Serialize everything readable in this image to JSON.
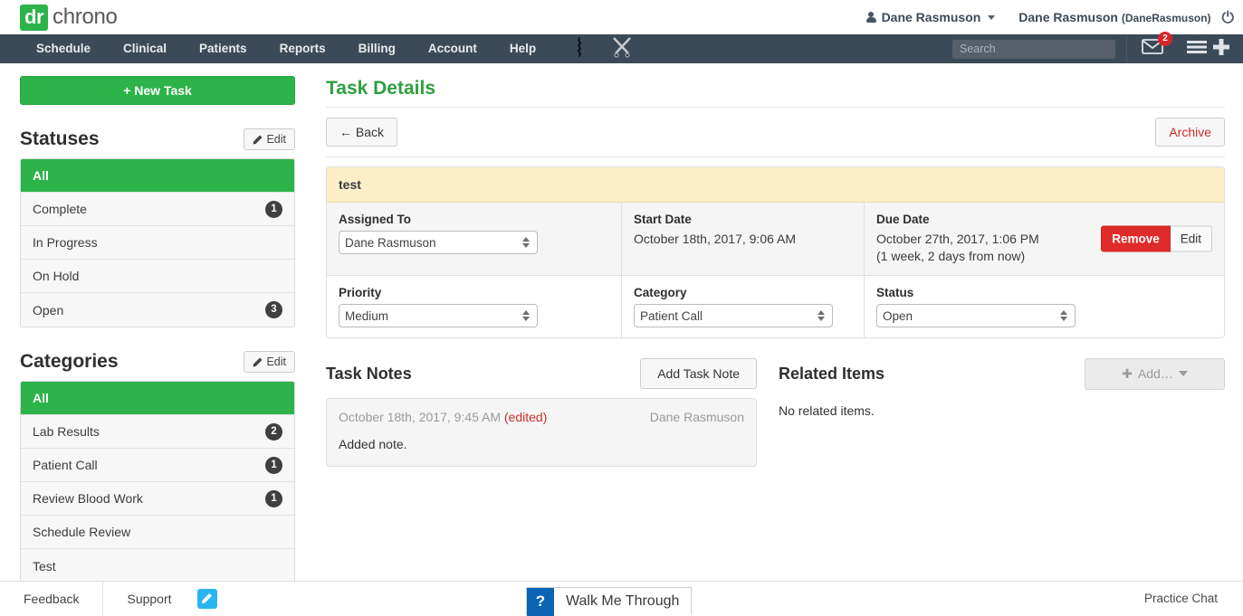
{
  "brand": {
    "logo_prefix": "dr",
    "logo_suffix": "chrono",
    "green": "#2cb34a",
    "navy": "#3a4a58"
  },
  "topbar": {
    "user_dropdown": "Dane Rasmuson",
    "account_name": "Dane Rasmuson",
    "account_handle": "(DaneRasmuson)",
    "person_icon": "person-icon",
    "power_icon": "power-icon"
  },
  "nav": {
    "items": [
      {
        "label": "Schedule"
      },
      {
        "label": "Clinical"
      },
      {
        "label": "Patients"
      },
      {
        "label": "Reports"
      },
      {
        "label": "Billing"
      },
      {
        "label": "Account"
      },
      {
        "label": "Help"
      }
    ],
    "icons": [
      {
        "name": "rod-of-asclepius-icon"
      },
      {
        "name": "crossed-swords-icon"
      }
    ],
    "search_placeholder": "Search",
    "search_value": "",
    "messages_badge": "2",
    "messages_icon": "envelope-icon",
    "menu_icon": "hamburger-icon",
    "add_icon": "plus-icon"
  },
  "sidebar": {
    "new_task_label": "+ New Task",
    "statuses": {
      "title": "Statuses",
      "edit_label": "Edit",
      "items": [
        {
          "label": "All",
          "count": "",
          "active": true
        },
        {
          "label": "Complete",
          "count": "1",
          "active": false
        },
        {
          "label": "In Progress",
          "count": "",
          "active": false
        },
        {
          "label": "On Hold",
          "count": "",
          "active": false
        },
        {
          "label": "Open",
          "count": "3",
          "active": false
        }
      ]
    },
    "categories": {
      "title": "Categories",
      "edit_label": "Edit",
      "items": [
        {
          "label": "All",
          "count": "",
          "active": true
        },
        {
          "label": "Lab Results",
          "count": "2",
          "active": false
        },
        {
          "label": "Patient Call",
          "count": "1",
          "active": false
        },
        {
          "label": "Review Blood Work",
          "count": "1",
          "active": false
        },
        {
          "label": "Schedule Review",
          "count": "",
          "active": false
        },
        {
          "label": "Test",
          "count": "",
          "active": false
        }
      ]
    }
  },
  "main": {
    "page_title": "Task Details",
    "back_label": "← Back",
    "archive_label": "Archive",
    "task": {
      "title": "test",
      "assigned_to_label": "Assigned To",
      "assigned_to_value": "Dane Rasmuson",
      "start_date_label": "Start Date",
      "start_date_value": "October 18th, 2017, 9:06 AM",
      "due_date_label": "Due Date",
      "due_date_value": "October 27th, 2017, 1:06 PM",
      "due_date_relative": "(1 week, 2 days from now)",
      "due_remove_label": "Remove",
      "due_edit_label": "Edit",
      "priority_label": "Priority",
      "priority_value": "Medium",
      "category_label": "Category",
      "category_value": "Patient Call",
      "status_label": "Status",
      "status_value": "Open"
    },
    "notes": {
      "title": "Task Notes",
      "add_label": "Add Task Note",
      "entries": [
        {
          "timestamp": "October 18th, 2017, 9:45 AM",
          "edited": "(edited)",
          "author": "Dane Rasmuson",
          "body": "Added note."
        }
      ]
    },
    "related": {
      "title": "Related Items",
      "add_label": "Add…",
      "add_plus": "✚",
      "empty_text": "No related items."
    }
  },
  "footer": {
    "feedback_label": "Feedback",
    "support_label": "Support",
    "feedback_icon": "pencil-icon",
    "walk_me_through_q": "?",
    "walk_me_through_label": "Walk Me Through",
    "practice_chat_label": "Practice Chat"
  }
}
